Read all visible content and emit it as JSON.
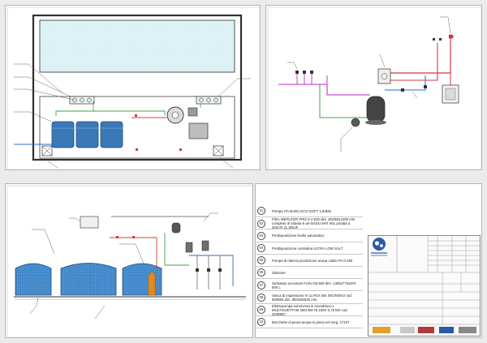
{
  "legend": {
    "items": [
      {
        "num": "01",
        "text": "Pompa ITA BADU ECO SOFT 1,60kW"
      },
      {
        "num": "02",
        "text": "Filtro WEFILTER PRO-3 V-030 dim. Ø1050x1200 mm completo di valvola 6 vie BADU MAT 961 portata a 40m³/h 11,30m/h"
      },
      {
        "num": "03",
        "text": "Predisposizione livello automatico"
      },
      {
        "num": "04",
        "text": "Predisposizione centralina ULTRA LOW SALT"
      },
      {
        "num": "05",
        "text": "Pompa di rilancio produzione acqua calda ITA 0-180"
      },
      {
        "num": "06",
        "text": "Skimmer"
      },
      {
        "num": "07",
        "text": "Serbatoio accumulo FUSI CB-500 dim. 1305x770x670 500 L"
      },
      {
        "num": "08",
        "text": "Vasca di espansione IV 11 ROI 304 SKONOKO rad. 600994 dim. Ø2048x630 mm"
      },
      {
        "num": "09",
        "text": "Elettropompa sommersa in monoblocco MULTIGUETTAM 30M 0M-75 230V 0,75 kW cod. 4049987"
      },
      {
        "num": "10",
        "text": "Bocchette di presa acqua in piena nel sorg. 17107"
      }
    ]
  }
}
